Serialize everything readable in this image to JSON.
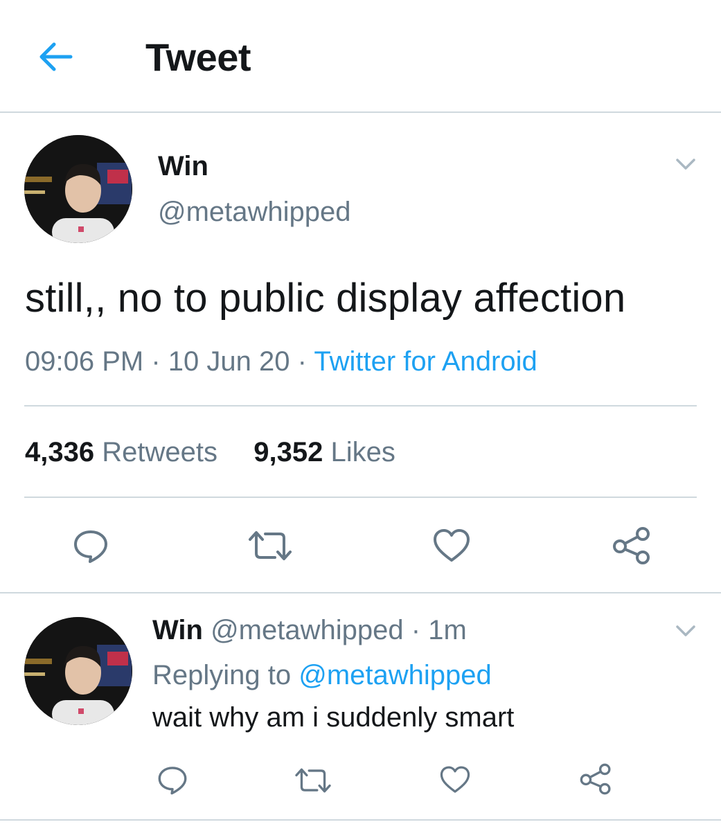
{
  "header": {
    "title": "Tweet",
    "back_icon": "arrow-left-icon"
  },
  "colors": {
    "accent": "#1da1f2",
    "muted": "#657786",
    "text": "#14171a",
    "divider": "#cfd9de"
  },
  "tweet": {
    "name": "Win",
    "handle": "@metawhipped",
    "text": "still,, no to public display affection",
    "time": "09:06 PM",
    "date": "10 Jun 20",
    "separator": "·",
    "source": "Twitter for Android",
    "retweets_count": "4,336",
    "retweets_label": "Retweets",
    "likes_count": "9,352",
    "likes_label": "Likes"
  },
  "reply": {
    "name": "Win",
    "handle": "@metawhipped",
    "separator": "·",
    "age": "1m",
    "replying_label": "Replying to",
    "replying_to": "@metawhipped",
    "text": "wait why am i suddenly smart"
  },
  "actions": [
    "reply-icon",
    "retweet-icon",
    "like-icon",
    "share-icon"
  ]
}
